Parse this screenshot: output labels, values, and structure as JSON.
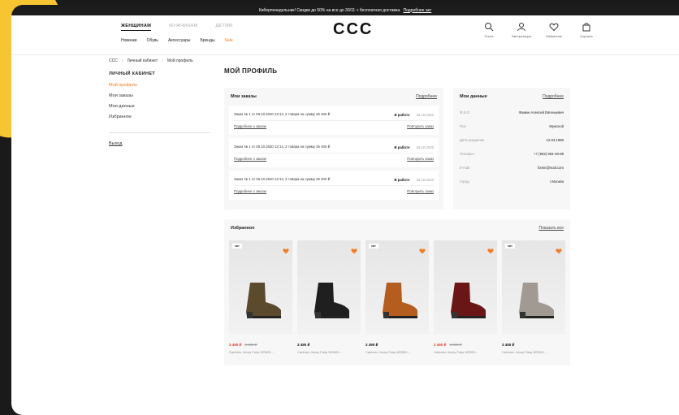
{
  "promo": {
    "text": "Киберпонедельник! Скидки до 50% на все до 30/11 + бесплатная доставка.",
    "link": "Подробнее акт"
  },
  "nav": {
    "main": [
      "ЖЕНЩИНАМ",
      "МУЖЧИНАМ",
      "ДЕТЯМ"
    ],
    "active_index": 0,
    "sub": [
      "Новинки",
      "Обувь",
      "Аксессуары",
      "Бренды",
      "Sale"
    ]
  },
  "logo": "CCC",
  "header_icons": [
    {
      "icon": "search-icon",
      "label": "Поиск"
    },
    {
      "icon": "user-icon",
      "label": "Авторизация"
    },
    {
      "icon": "heart-icon",
      "label": "Избранное"
    },
    {
      "icon": "bag-icon",
      "label": "Корзина"
    }
  ],
  "breadcrumbs": [
    "CCC",
    "Личный кабинет",
    "Мой профиль"
  ],
  "sidebar": {
    "title": "ЛИЧНЫЙ КАБИНЕТ",
    "items": [
      "Мой профиль",
      "Мои заказы",
      "Мои данные",
      "Избранное"
    ],
    "active_index": 0,
    "logout": "Выход"
  },
  "page_title": "МОЙ ПРОФИЛЬ",
  "orders": {
    "title": "Мои заказы",
    "more": "Подробнее",
    "rows": [
      {
        "desc": "Заказ № 1 от 06.10.2020 13:14, 2 товара на сумму 25 400 ₽",
        "status": "В работе",
        "date": "18.10.2020",
        "details": "Подробнее о заказе",
        "repeat": "Повторить заказ"
      },
      {
        "desc": "Заказ № 1 от 06.10.2020 13:14, 2 товара на сумму 25 400 ₽",
        "status": "В работе",
        "date": "18.10.2020",
        "details": "Подробнее о заказе",
        "repeat": "Повторить заказ"
      },
      {
        "desc": "Заказ № 1 от 06.10.2020 13:14, 2 товара на сумму 25 400 ₽",
        "status": "В работе",
        "date": "18.10.2020",
        "details": "Подробнее о заказе",
        "repeat": "Повторить заказ"
      }
    ]
  },
  "mydata": {
    "title": "Мои данные",
    "more": "Подробнее",
    "fields": [
      {
        "k": "Ф.И.О.",
        "v": "Фомин Алексей Евгеньевич"
      },
      {
        "k": "Пол",
        "v": "Мужской"
      },
      {
        "k": "Дата рождения",
        "v": "12.03.1980"
      },
      {
        "k": "Телефон",
        "v": "+7 (902) 894-49-89"
      },
      {
        "k": "E-mail",
        "v": "fomin@mail.com"
      },
      {
        "k": "Город",
        "v": "г.Москва"
      }
    ]
  },
  "favorites": {
    "title": "Избранное",
    "show_all": "Показать все",
    "products": [
      {
        "badge": "хит",
        "price": "3 490 ₽",
        "old_price": "5 590 ₽",
        "sale": true,
        "name": "Cartomo Jenny Fairy WS520...",
        "color": "#5c4a2e"
      },
      {
        "badge": "",
        "price": "3 490 ₽",
        "old_price": "",
        "sale": false,
        "name": "Cartomo Jenny Fairy WS520...",
        "color": "#1f1f1f"
      },
      {
        "badge": "хит",
        "price": "3 490 ₽",
        "old_price": "",
        "sale": false,
        "name": "Cartomo Jenny Fairy WS520...",
        "color": "#b45d1e"
      },
      {
        "badge": "",
        "price": "3 490 ₽",
        "old_price": "5 590 ₽",
        "sale": true,
        "name": "Cartomo Jenny Fairy WS520...",
        "color": "#6b1616"
      },
      {
        "badge": "хит",
        "price": "3 490 ₽",
        "old_price": "",
        "sale": false,
        "name": "Cartomo Jenny Fairy WS520...",
        "color": "#a09a92"
      }
    ]
  },
  "colors": {
    "accent": "#f47b20",
    "sale": "#e63b2e",
    "heart": "#f47b20"
  }
}
